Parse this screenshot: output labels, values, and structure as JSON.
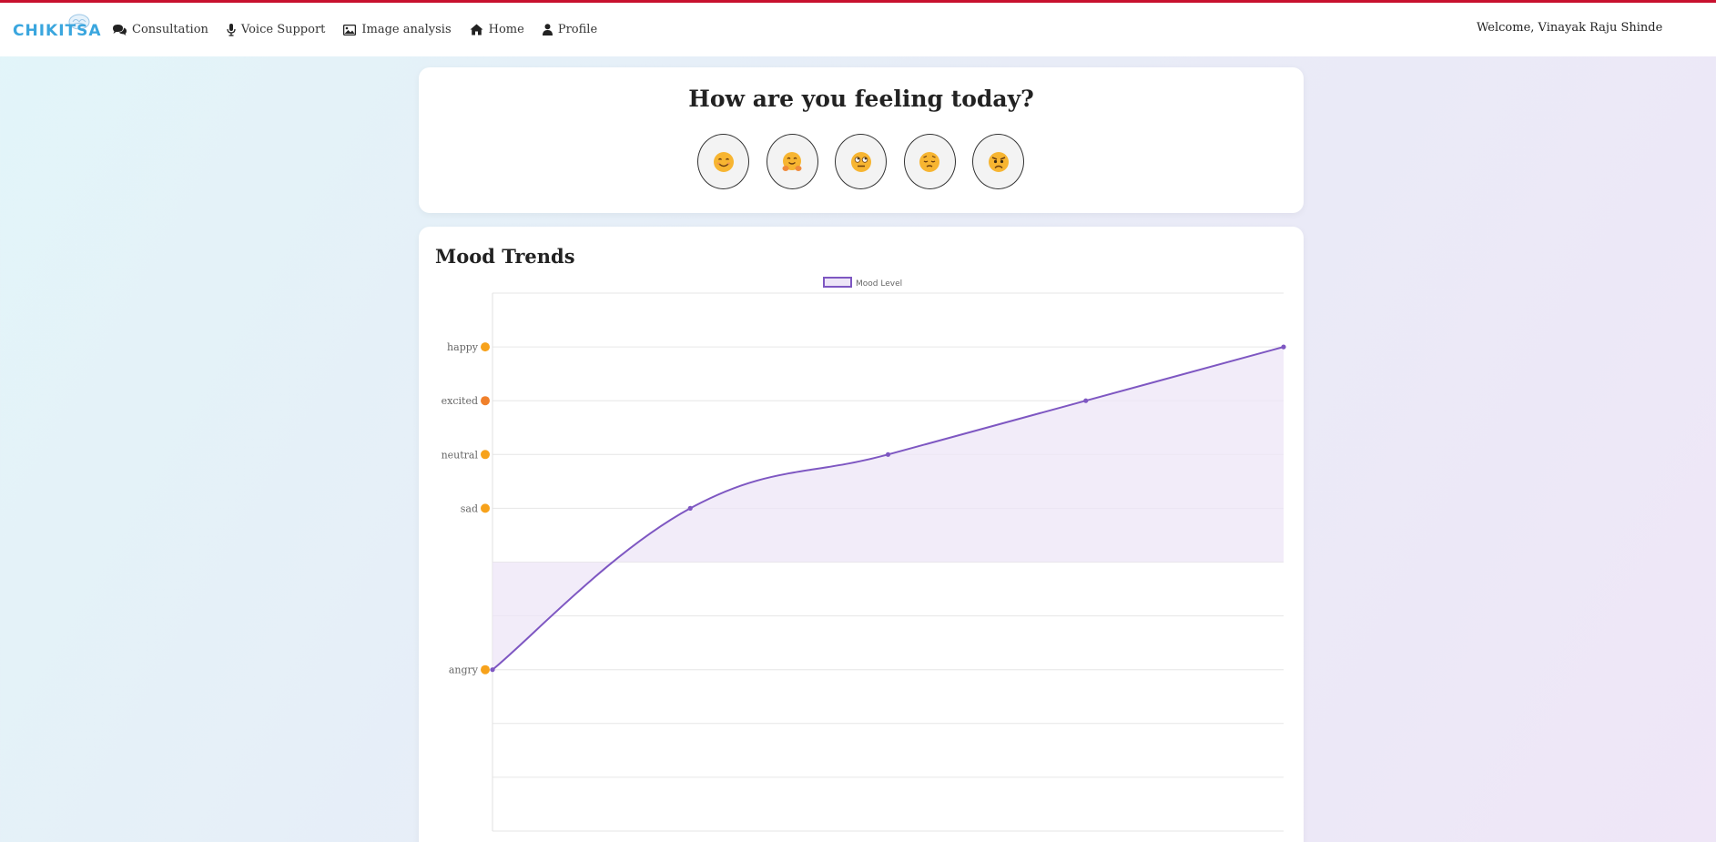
{
  "brand": {
    "name": "CHIKITSA"
  },
  "nav": {
    "items": [
      {
        "label": "Consultation",
        "icon": "comments-icon"
      },
      {
        "label": "Voice Support",
        "icon": "microphone-icon"
      },
      {
        "label": "Image analysis",
        "icon": "image-icon"
      },
      {
        "label": "Home",
        "icon": "home-icon"
      },
      {
        "label": "Profile",
        "icon": "user-icon"
      }
    ],
    "welcome": "Welcome, Vinayak Raju Shinde"
  },
  "mood_picker": {
    "title": "How are you feeling today?",
    "options": [
      {
        "mood": "happy",
        "emoji": "smiling-face"
      },
      {
        "mood": "excited",
        "emoji": "hugging-face"
      },
      {
        "mood": "neutral",
        "emoji": "rolling-eyes-face"
      },
      {
        "mood": "sad",
        "emoji": "pensive-face"
      },
      {
        "mood": "angry",
        "emoji": "angry-face"
      }
    ]
  },
  "trends": {
    "title": "Mood Trends"
  },
  "colors": {
    "line": "#7e57c2",
    "fill": "#ede5f7",
    "accent_bar": "#c8102e",
    "brand": "#3aa6de"
  },
  "chart_data": {
    "type": "area",
    "legend": [
      "Mood Level"
    ],
    "legend_position": "top",
    "grid": true,
    "y_tick_labels": [
      {
        "value": 1,
        "label": "angry"
      },
      {
        "value": 4,
        "label": "sad"
      },
      {
        "value": 5,
        "label": "neutral"
      },
      {
        "value": 6,
        "label": "excited"
      },
      {
        "value": 7,
        "label": "happy"
      }
    ],
    "ylim": [
      -2,
      8
    ],
    "fill_baseline": 3,
    "series": [
      {
        "name": "Mood Level",
        "values": [
          1,
          4,
          5,
          6,
          7
        ]
      }
    ]
  }
}
